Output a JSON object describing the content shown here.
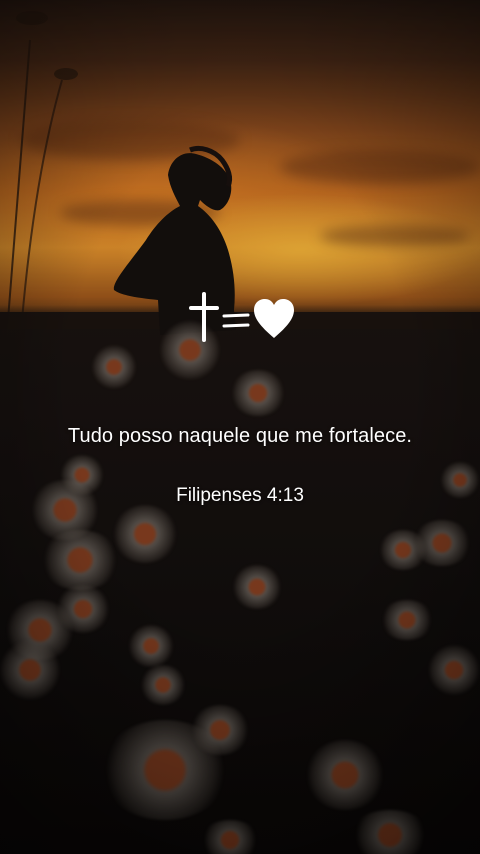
{
  "verse": {
    "text": "Tudo posso naquele que me fortalece.",
    "reference": "Filipenses 4:13"
  },
  "symbols": [
    "cross-icon",
    "equals-icon",
    "heart-icon"
  ],
  "colors": {
    "text": "#ffffff",
    "sky_glow": "#e4962f",
    "ground": "#110d0c"
  }
}
